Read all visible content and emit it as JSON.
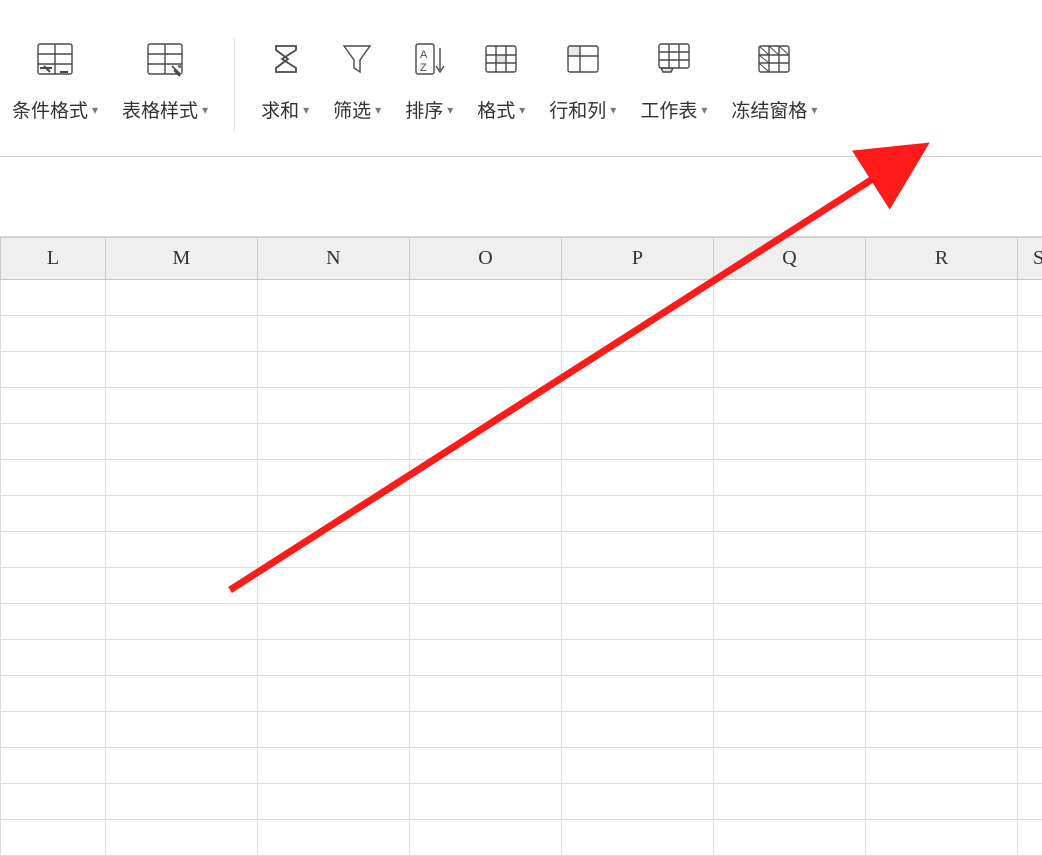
{
  "ribbon": {
    "items": [
      {
        "id": "conditional-format",
        "label": "条件格式"
      },
      {
        "id": "table-style",
        "label": "表格样式"
      },
      {
        "id": "sum",
        "label": "求和"
      },
      {
        "id": "filter",
        "label": "筛选"
      },
      {
        "id": "sort",
        "label": "排序"
      },
      {
        "id": "format",
        "label": "格式"
      },
      {
        "id": "rows-cols",
        "label": "行和列"
      },
      {
        "id": "worksheet",
        "label": "工作表"
      },
      {
        "id": "freeze-panes",
        "label": "冻结窗格"
      }
    ]
  },
  "columns": [
    "L",
    "M",
    "N",
    "O",
    "P",
    "Q",
    "R",
    "S"
  ],
  "gridRows": 16
}
